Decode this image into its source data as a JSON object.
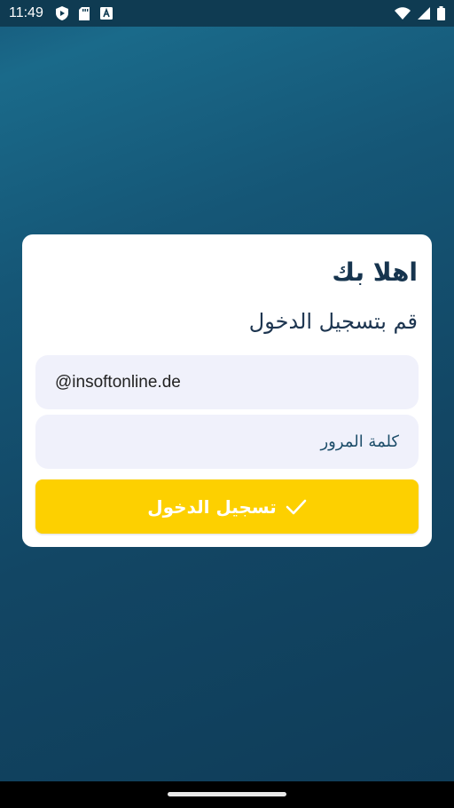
{
  "status_bar": {
    "time": "11:49",
    "icons_left": [
      "shield-play-icon",
      "sd-card-icon",
      "keyboard-a-icon"
    ],
    "icons_right": [
      "wifi-icon",
      "signal-icon",
      "battery-icon"
    ]
  },
  "login": {
    "greeting": "اهلا بك",
    "subtitle": "قم بتسجيل الدخول",
    "email_value": "@insoftonline.de",
    "password_placeholder": "كلمة المرور",
    "button_label": "تسجيل الدخول",
    "button_icon": "check-icon"
  },
  "colors": {
    "button": "#fdd000",
    "field_bg": "#f0f1fb",
    "heading": "#16344e",
    "background": "#124664"
  }
}
